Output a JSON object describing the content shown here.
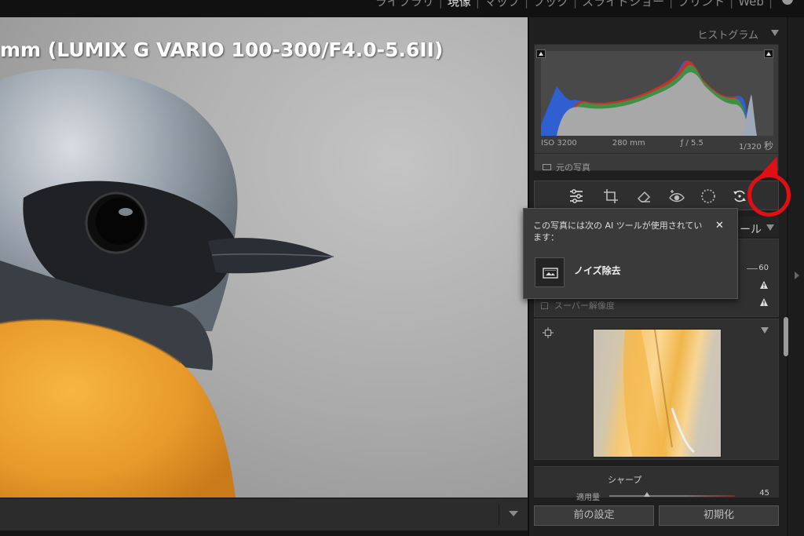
{
  "modules": {
    "items": [
      {
        "label": "ライブラリ",
        "active": false
      },
      {
        "label": "現像",
        "active": true
      },
      {
        "label": "マップ",
        "active": false
      },
      {
        "label": "ブック",
        "active": false
      },
      {
        "label": "スライドショー",
        "active": false
      },
      {
        "label": "プリント",
        "active": false
      },
      {
        "label": "Web",
        "active": false
      }
    ],
    "separator": "|"
  },
  "photo": {
    "overlay_text": "mm (LUMIX G VARIO 100-300/F4.0-5.6II)"
  },
  "histogram": {
    "title": "ヒストグラム",
    "iso": "ISO 3200",
    "focal": "280 mm",
    "aperture": "ƒ / 5.5",
    "shutter": "1/320",
    "shutter_unit": "秒",
    "original_photo_label": "元の写真"
  },
  "tools": [
    "edit-sliders-icon",
    "crop-icon",
    "eraser-icon",
    "red-eye-icon",
    "masking-icon",
    "ai-update-icon"
  ],
  "popup": {
    "message": "この写真には次の AI ツールが使用されています：",
    "close": "✕",
    "item": "ノイズ除去"
  },
  "basic": {
    "header_tail": "ール",
    "enhance_value": "60",
    "super_resolution_label": "スーパー解像度"
  },
  "sharpening": {
    "title": "シャープ",
    "amount_label": "適用量",
    "amount_value": "45",
    "amount": 45,
    "amount_max": 150
  },
  "buttons": {
    "previous": "前の設定",
    "reset": "初期化"
  },
  "colors": {
    "annotation": "#e10f14",
    "hist_red": "#c8322b",
    "hist_green": "#3f8f45",
    "hist_blue": "#2f5fd0",
    "hist_gray": "#a8a8a8"
  }
}
